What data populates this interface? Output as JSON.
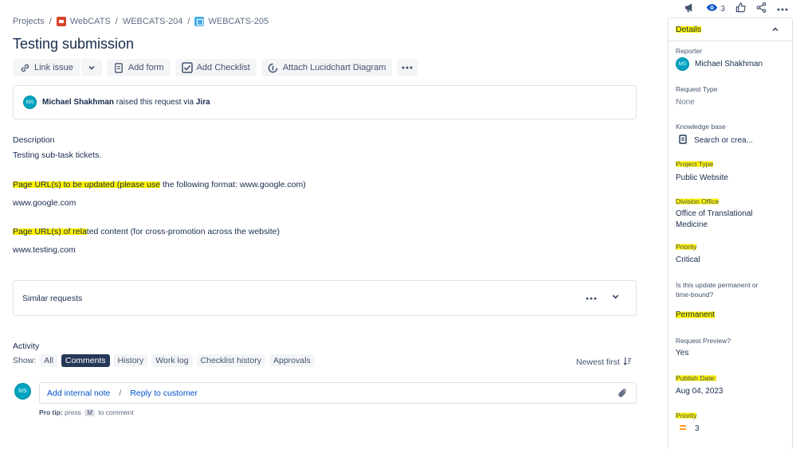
{
  "breadcrumb": {
    "projects": "Projects",
    "sep": "/",
    "project": "WebCATS",
    "parent": "WEBCATS-204",
    "current": "WEBCATS-205"
  },
  "issue": {
    "title": "Testing submission"
  },
  "toolbar": {
    "link_issue": "Link issue",
    "add_form": "Add form",
    "add_checklist": "Add Checklist",
    "attach_lucidchart": "Attach Lucidchart Diagram"
  },
  "request": {
    "avatar_initials": "MS",
    "user": "Michael Shakhman",
    "middle": " raised this request via ",
    "channel": "Jira"
  },
  "description": {
    "label": "Description",
    "text": "Testing sub-task tickets."
  },
  "fields": {
    "page_urls_label_hl": "Page URL(s) to be updated (please use",
    "page_urls_label_rest": " the following format: www.google.com)",
    "page_urls_value": "www.google.com",
    "related_label_hl": "Page URL(s) of rela",
    "related_label_rest": "ted content (for cross-promotion across the website)",
    "related_value": "www.testing.com"
  },
  "similar": {
    "label": "Similar requests"
  },
  "activity": {
    "label": "Activity",
    "show": "Show:",
    "filters": [
      "All",
      "Comments",
      "History",
      "Work log",
      "Checklist history",
      "Approvals"
    ],
    "active_filter": "Comments",
    "sort": "Newest first",
    "avatar_initials": "MS",
    "internal_note": "Add internal note",
    "slash": "/",
    "reply": "Reply to customer",
    "protip_label": "Pro tip:",
    "protip_pre": "press",
    "protip_key": "M",
    "protip_post": "to comment"
  },
  "topbar": {
    "watch_count": "3"
  },
  "details": {
    "header": "Details",
    "reporter_label": "Reporter",
    "reporter_initials": "MS",
    "reporter": "Michael Shakhman",
    "request_type_label": "Request Type",
    "request_type": "None",
    "kb_label": "Knowledge base",
    "kb_value": "Search or crea...",
    "project_type_label": "Project Type",
    "project_type": "Public Website",
    "division_label": "Division Office",
    "division_line1": "Office of Translational",
    "division_line2": "Medicine",
    "priority_label": "Priority",
    "priority": "Critical",
    "permanent_label_1": "Is this update permanent or",
    "permanent_label_2": "time-bound?",
    "permanent": "Permanent",
    "preview_label": "Request Preview?",
    "preview": "Yes",
    "publish_label": "Publish Date:",
    "publish": "Aug 04, 2023",
    "priority2_label": "Priority",
    "priority2": "3"
  },
  "colors": {
    "highlight": "#fff200",
    "link": "#0052cc",
    "active_chip": "#253858",
    "avatar": "#00a3bf"
  }
}
